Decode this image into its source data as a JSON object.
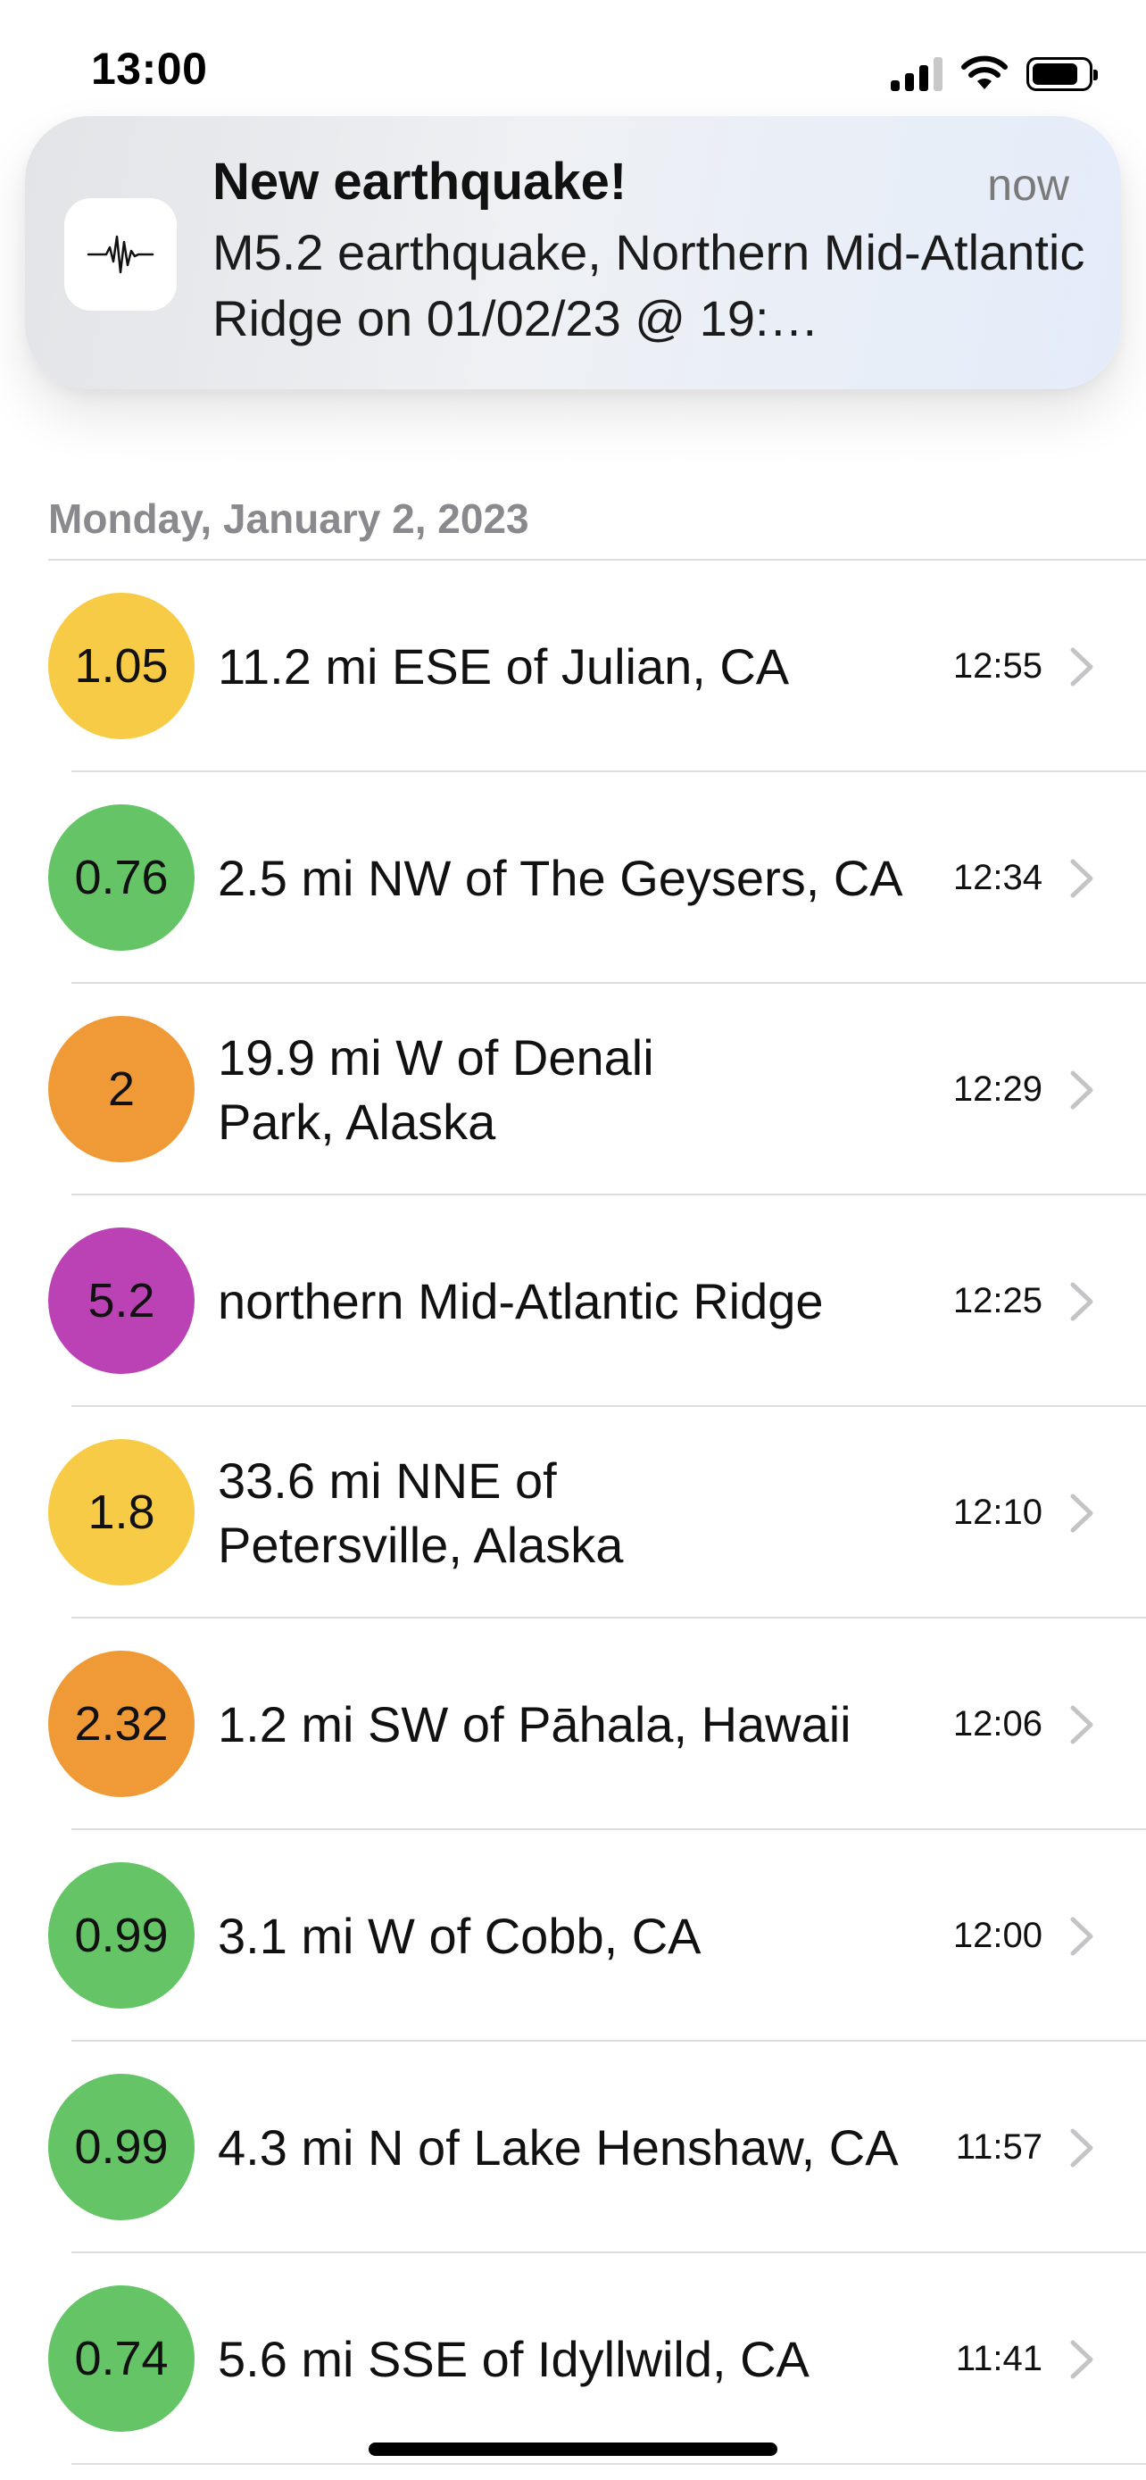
{
  "status_bar": {
    "time": "13:00"
  },
  "notification": {
    "title": "New earthquake!",
    "time": "now",
    "body": "M5.2 earthquake, Northern Mid-Atlantic Ridge on 01/02/23 @ 19:…",
    "icon": "seismograph-icon"
  },
  "list": {
    "section_header": "Monday, January 2, 2023",
    "items": [
      {
        "magnitude": "1.05",
        "place": "11.2 mi ESE of Julian, CA",
        "time": "12:55",
        "color": "#f7cb45"
      },
      {
        "magnitude": "0.76",
        "place": "2.5 mi NW of The Geysers, CA",
        "time": "12:34",
        "color": "#64c466"
      },
      {
        "magnitude": "2",
        "place": "19.9 mi W of Denali Park, Alaska",
        "time": "12:29",
        "color": "#f09a37"
      },
      {
        "magnitude": "5.2",
        "place": "northern Mid-Atlantic Ridge",
        "time": "12:25",
        "color": "#bb42b5"
      },
      {
        "magnitude": "1.8",
        "place": "33.6 mi NNE of Petersville, Alaska",
        "time": "12:10",
        "color": "#f7cb45"
      },
      {
        "magnitude": "2.32",
        "place": "1.2 mi SW of Pāhala, Hawaii",
        "time": "12:06",
        "color": "#f09a37"
      },
      {
        "magnitude": "0.99",
        "place": "3.1 mi W of Cobb, CA",
        "time": "12:00",
        "color": "#64c466"
      },
      {
        "magnitude": "0.99",
        "place": "4.3 mi N of Lake Henshaw, CA",
        "time": "11:57",
        "color": "#64c466"
      },
      {
        "magnitude": "0.74",
        "place": "5.6 mi SSE of Idyllwild, CA",
        "time": "11:41",
        "color": "#64c466"
      }
    ]
  }
}
